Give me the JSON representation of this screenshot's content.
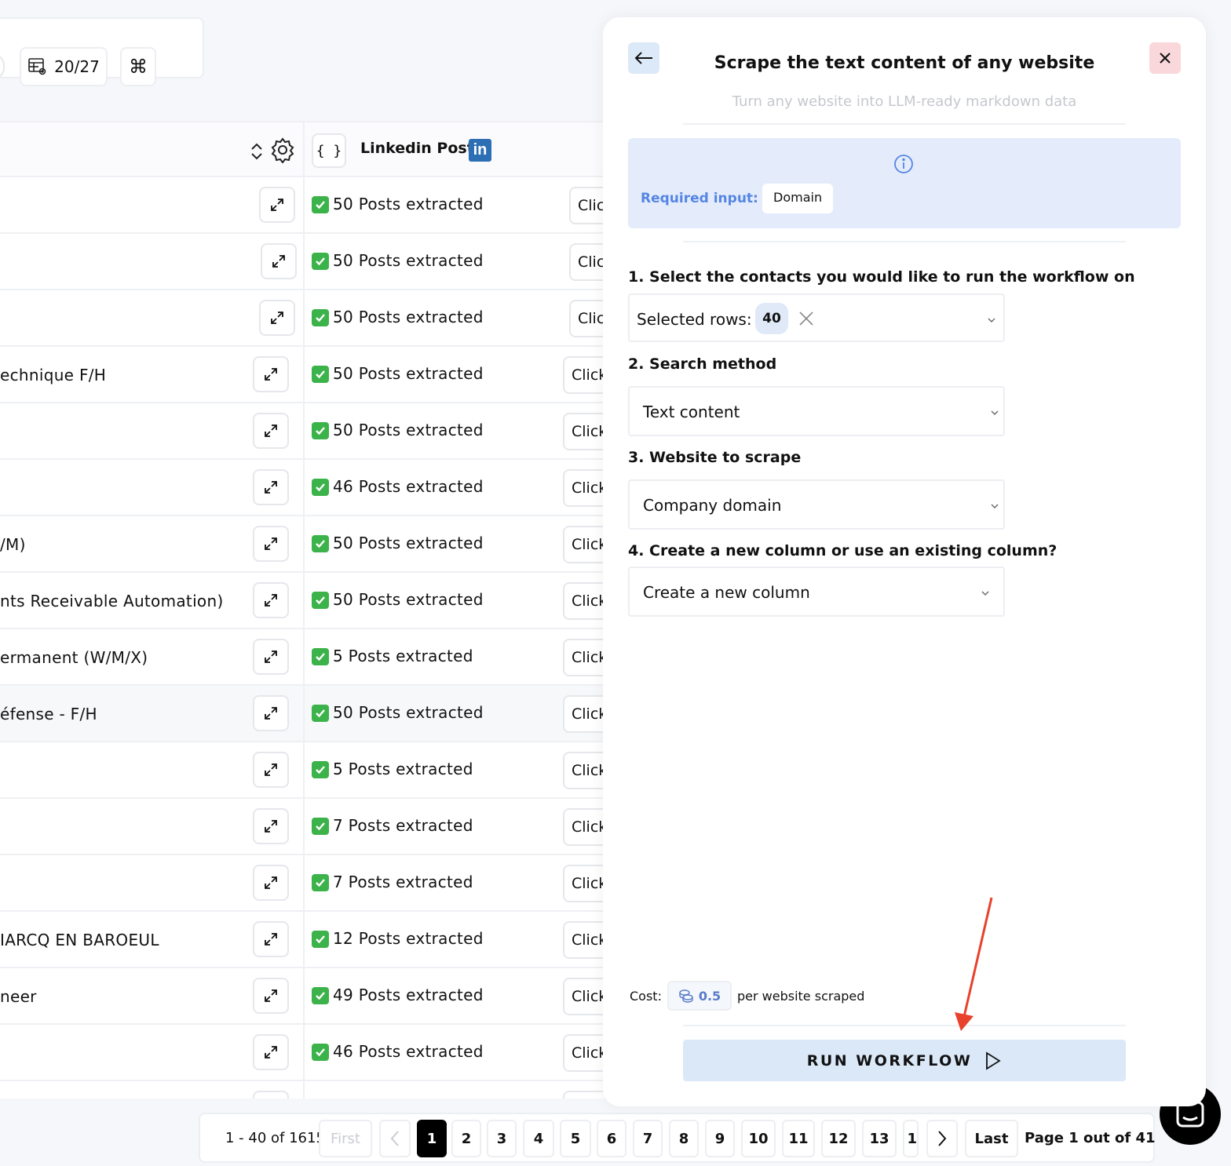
{
  "toolbar": {
    "columns_count": "20/27",
    "command_icon": "⌘"
  },
  "table": {
    "column_title": "Linkedin Post",
    "braces_label": "{ }",
    "linkedin_icon_text": "in",
    "rows": [
      {
        "text": "",
        "posts": "50 Posts extracted",
        "click": "Clic"
      },
      {
        "text": "",
        "posts": "50 Posts extracted",
        "click": "Clic"
      },
      {
        "text": "",
        "posts": "50 Posts extracted",
        "click": "Clic"
      },
      {
        "text": "echnique F/H",
        "posts": "50 Posts extracted",
        "click": "Click"
      },
      {
        "text": "",
        "posts": "50 Posts extracted",
        "click": "Click"
      },
      {
        "text": "",
        "posts": "46 Posts extracted",
        "click": "Click"
      },
      {
        "text": "/M)",
        "posts": "50 Posts extracted",
        "click": "Click"
      },
      {
        "text": "nts Receivable Automation)",
        "posts": "50 Posts extracted",
        "click": "Click"
      },
      {
        "text": "ermanent (W/M/X)",
        "posts": "5 Posts extracted",
        "click": "Click"
      },
      {
        "text": "éfense - F/H",
        "posts": "50 Posts extracted",
        "click": "Click"
      },
      {
        "text": "",
        "posts": "5 Posts extracted",
        "click": "Click"
      },
      {
        "text": "",
        "posts": "7 Posts extracted",
        "click": "Click"
      },
      {
        "text": "",
        "posts": "7 Posts extracted",
        "click": "Click"
      },
      {
        "text": "IARCQ EN BAROEUL",
        "posts": "12 Posts extracted",
        "click": "Click"
      },
      {
        "text": "neer",
        "posts": "49 Posts extracted",
        "click": "Click"
      },
      {
        "text": "",
        "posts": "46 Posts extracted",
        "click": "Click"
      },
      {
        "text": "",
        "posts": "",
        "click": ""
      }
    ]
  },
  "pagination": {
    "range": "1 - 40 of 1615",
    "first": "First",
    "pages": [
      "1",
      "2",
      "3",
      "4",
      "5",
      "6",
      "7",
      "8",
      "9",
      "10",
      "11",
      "12",
      "13",
      "1"
    ],
    "active_page": "1",
    "last": "Last",
    "info": "Page 1 out of 41"
  },
  "panel": {
    "title": "Scrape the text content of any website",
    "subtitle": "Turn any website into LLM-ready markdown data",
    "required_label": "Required input:",
    "required_value": "Domain",
    "step1": {
      "label": "1. Select the contacts you would like to run the workflow on",
      "value": "Selected rows:",
      "count": "40"
    },
    "step2": {
      "label": "2. Search method",
      "value": "Text content"
    },
    "step3": {
      "label": "3. Website to scrape",
      "value": "Company domain"
    },
    "step4": {
      "label": "4. Create a new column or use an existing column?",
      "value": "Create a new column"
    },
    "cost_label": "Cost:",
    "cost_value": "0.5",
    "cost_suffix": "per website scraped",
    "run_label": "RUN WORKFLOW"
  },
  "colors": {
    "accent_blue": "#5585e3",
    "info_bg": "#e4ecfb",
    "run_button_bg": "#dbe8f8",
    "close_bg": "#fad7da",
    "check_green": "#3cb34a",
    "annotation_arrow": "#e8412c",
    "linkedin_blue": "#2d6fb4"
  },
  "icons": [
    "table-settings-icon",
    "command-icon",
    "sort-icon",
    "gear-icon",
    "braces-icon",
    "linkedin-icon",
    "expand-icon",
    "check-icon",
    "back-arrow-icon",
    "close-icon",
    "info-icon",
    "clear-icon",
    "chevron-down-icon",
    "coins-icon",
    "play-icon",
    "chevron-left-icon",
    "chevron-right-icon",
    "chat-icon"
  ]
}
